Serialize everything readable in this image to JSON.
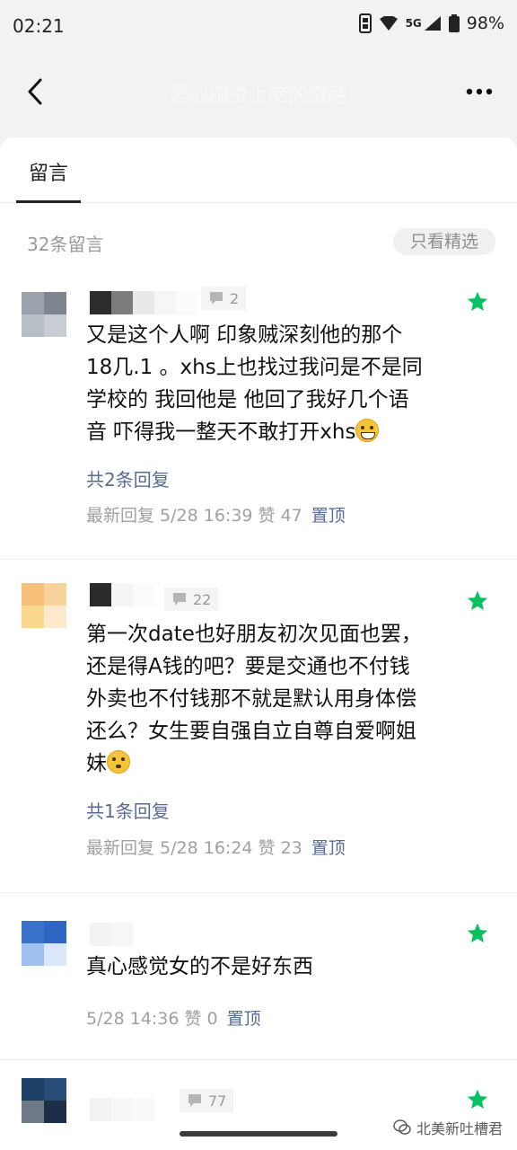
{
  "status_bar": {
    "time": "02:21",
    "network": "5G",
    "battery": "98%"
  },
  "nav": {
    "title": "恶心精虫上脑的奇葩",
    "back_icon": "chevron-left-icon",
    "more_icon": "more-horizontal-icon"
  },
  "tabs": [
    {
      "label": "留言",
      "active": true
    }
  ],
  "comments_header": {
    "count_label": "32条留言",
    "filter_label": "只看精选"
  },
  "comments": [
    {
      "reply_badge": "2",
      "text_lines": [
        "又是这个人啊 印象贼深刻他的那个",
        "18几.1 。xhs上也找过我问是不是同",
        "学校的 我回他是 他回了我好几个语",
        "音 吓得我一整天不敢打开xhs"
      ],
      "emoji": "grinning-face",
      "replies_link": "共2条回复",
      "meta": "最新回复 5/28 16:39 赞 47",
      "pin_label": "置顶",
      "starred": true
    },
    {
      "reply_badge": "22",
      "text_lines": [
        "第一次date也好朋友初次见面也罢，",
        "还是得A钱的吧？要是交通也不付钱",
        "外卖也不付钱那不就是默认用身体偿",
        "还么？女生要自强自立自尊自爱啊姐",
        "妹"
      ],
      "emoji": "flushed-face",
      "replies_link": "共1条回复",
      "meta": "最新回复 5/28 16:24 赞 23",
      "pin_label": "置顶",
      "starred": true
    },
    {
      "reply_badge": "",
      "text_lines": [
        "真心感觉女的不是好东西"
      ],
      "emoji": "",
      "replies_link": "",
      "meta": "5/28 14:36 赞 0",
      "pin_label": "置顶",
      "starred": true
    },
    {
      "reply_badge": "77",
      "text_lines": [],
      "emoji": "",
      "replies_link": "",
      "meta": "",
      "pin_label": "",
      "starred": true
    }
  ],
  "watermark": "北美新吐槽君",
  "colors": {
    "star_green": "#07c160",
    "link_blue": "#576b95",
    "muted_gray": "#a0a0a0"
  }
}
